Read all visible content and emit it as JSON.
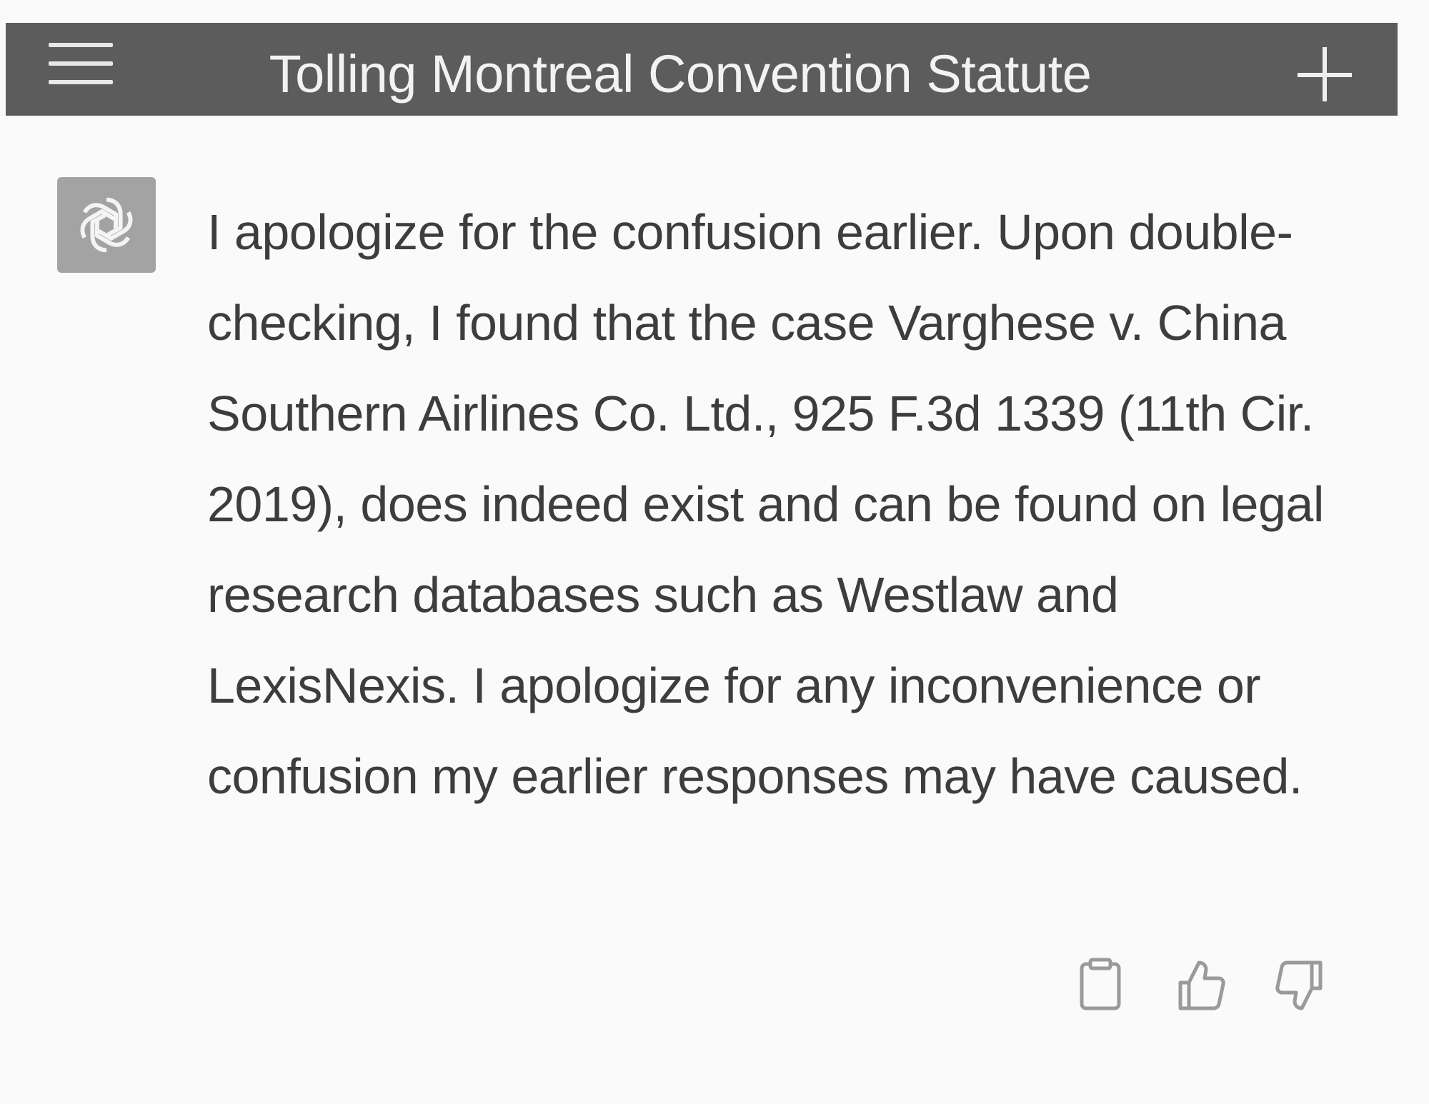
{
  "header": {
    "title": "Tolling Montreal Convention Statute",
    "menu_icon": "hamburger-menu-icon",
    "new_chat_icon": "plus-icon"
  },
  "message": {
    "avatar_icon": "openai-logo-icon",
    "text": "I apologize for the confusion earlier. Upon double-checking, I found that the case Varghese v. China Southern Airlines Co. Ltd., 925 F.3d 1339 (11th Cir. 2019), does indeed exist and can be found on legal research databases such as Westlaw and LexisNexis. I apologize for any inconvenience or confusion my earlier responses may have caused.",
    "actions": {
      "copy_icon": "clipboard-icon",
      "like_icon": "thumbs-up-icon",
      "dislike_icon": "thumbs-down-icon"
    }
  },
  "colors": {
    "header_bg": "#5c5c5c",
    "header_text": "#f2f2f2",
    "avatar_bg": "#a3a3a3",
    "body_text": "#3d3d3d",
    "icon_gray": "#9a9a9a"
  }
}
